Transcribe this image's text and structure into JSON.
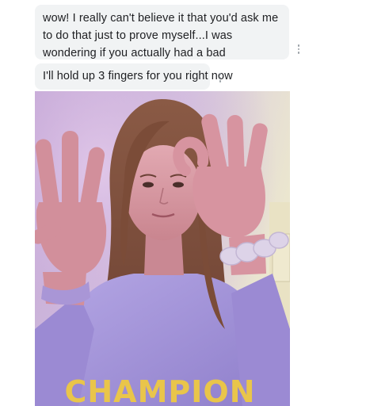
{
  "messages": [
    {
      "text": "wow! I really can't believe it that you'd ask me to do that just to prove myself...I was wondering if you actually had a bad experience that triggered it?"
    },
    {
      "text": "I'll hold up 3 fingers for you right now"
    }
  ],
  "photo": {
    "shirt_text": "CHAMPION",
    "colors": {
      "wall_top": "#c9b3d6",
      "wall_right": "#e6e0c8",
      "hair": "#7a4e3a",
      "skin": "#d79aa6",
      "sweater": "#a898d8",
      "scrunchie": "#d8cfe6"
    }
  },
  "icons": [
    "more-vert-icon"
  ]
}
